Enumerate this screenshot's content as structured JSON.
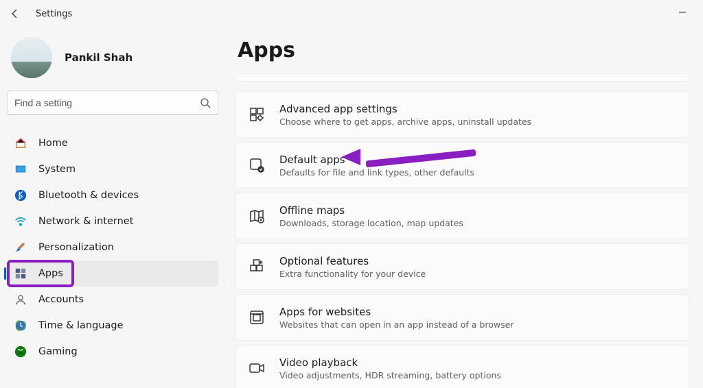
{
  "window": {
    "title": "Settings",
    "user_name": "Pankil Shah"
  },
  "search": {
    "placeholder": "Find a setting"
  },
  "sidebar": {
    "items": [
      {
        "id": "home",
        "label": "Home"
      },
      {
        "id": "system",
        "label": "System"
      },
      {
        "id": "bluetooth",
        "label": "Bluetooth & devices"
      },
      {
        "id": "network",
        "label": "Network & internet"
      },
      {
        "id": "personalization",
        "label": "Personalization"
      },
      {
        "id": "apps",
        "label": "Apps"
      },
      {
        "id": "accounts",
        "label": "Accounts"
      },
      {
        "id": "time",
        "label": "Time & language"
      },
      {
        "id": "gaming",
        "label": "Gaming"
      }
    ],
    "active_id": "apps"
  },
  "page": {
    "heading": "Apps",
    "rows": [
      {
        "id": "advanced",
        "title": "Advanced app settings",
        "subtitle": "Choose where to get apps, archive apps, uninstall updates"
      },
      {
        "id": "default",
        "title": "Default apps",
        "subtitle": "Defaults for file and link types, other defaults"
      },
      {
        "id": "maps",
        "title": "Offline maps",
        "subtitle": "Downloads, storage location, map updates"
      },
      {
        "id": "optional",
        "title": "Optional features",
        "subtitle": "Extra functionality for your device"
      },
      {
        "id": "websites",
        "title": "Apps for websites",
        "subtitle": "Websites that can open in an app instead of a browser"
      },
      {
        "id": "video",
        "title": "Video playback",
        "subtitle": "Video adjustments, HDR streaming, battery options"
      }
    ],
    "highlighted_row_id": "default"
  },
  "annotation": {
    "sidebar_highlight_id": "apps",
    "arrow_target_row_id": "default",
    "color": "#8a1fc1"
  }
}
